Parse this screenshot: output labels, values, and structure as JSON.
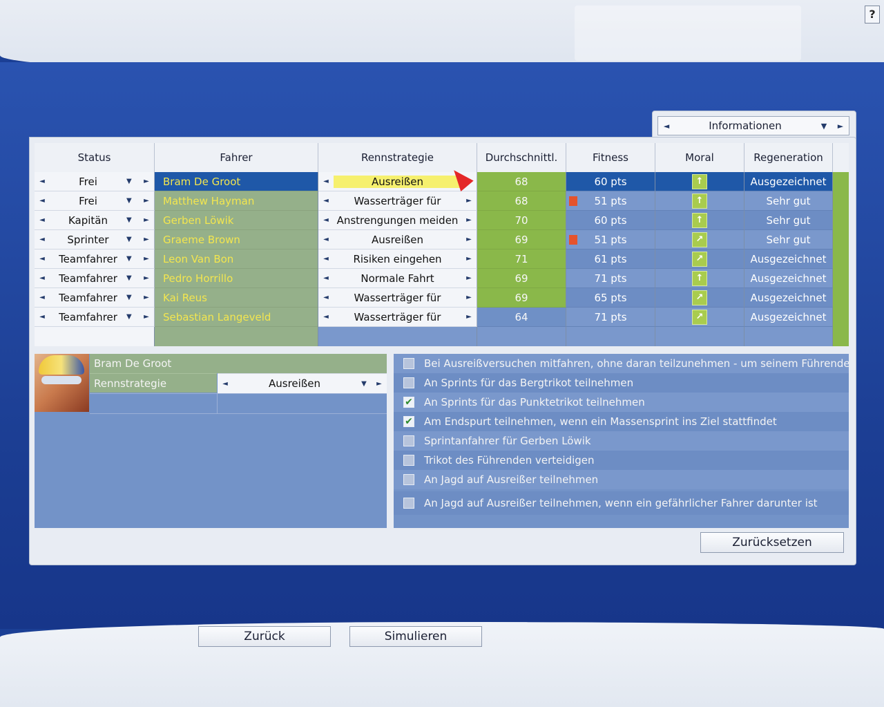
{
  "help_label": "?",
  "info_selector": {
    "label": "Informationen",
    "left_arrow": "◄",
    "right_arrow": "►",
    "dropdown": "▼"
  },
  "columns": [
    "Status",
    "Fahrer",
    "Rennstrategie",
    "Durchschnittl.",
    "Fitness",
    "Moral",
    "Regeneration"
  ],
  "riders": [
    {
      "status": "Frei",
      "name": "Bram De Groot",
      "strategy": "Ausreißen",
      "avg": "68",
      "fitness": "60 pts",
      "moral_icon": "arrow-up-icon",
      "regen": "Ausgezeichnet",
      "selected": true
    },
    {
      "status": "Frei",
      "name": "Matthew Hayman",
      "strategy": "Wasserträger für",
      "avg": "68",
      "fitness": "51 pts",
      "warning": true,
      "moral_icon": "arrow-up-icon",
      "regen": "Sehr gut"
    },
    {
      "status": "Kapitän",
      "name": "Gerben Löwik",
      "strategy": "Anstrengungen meiden",
      "avg": "70",
      "fitness": "60 pts",
      "moral_icon": "arrow-up-icon",
      "regen": "Sehr gut"
    },
    {
      "status": "Sprinter",
      "name": "Graeme Brown",
      "strategy": "Ausreißen",
      "avg": "69",
      "fitness": "51 pts",
      "warning": true,
      "moral_icon": "arrow-diag-icon",
      "regen": "Sehr gut"
    },
    {
      "status": "Teamfahrer",
      "name": "Leon Van Bon",
      "strategy": "Risiken eingehen",
      "avg": "71",
      "fitness": "61 pts",
      "moral_icon": "arrow-diag-icon",
      "regen": "Ausgezeichnet"
    },
    {
      "status": "Teamfahrer",
      "name": "Pedro Horrillo",
      "strategy": "Normale Fahrt",
      "avg": "69",
      "fitness": "71 pts",
      "moral_icon": "arrow-up-icon",
      "regen": "Ausgezeichnet"
    },
    {
      "status": "Teamfahrer",
      "name": "Kai Reus",
      "strategy": "Wasserträger für",
      "avg": "69",
      "fitness": "65 pts",
      "moral_icon": "arrow-diag-icon",
      "regen": "Ausgezeichnet"
    },
    {
      "status": "Teamfahrer",
      "name": "Sebastian Langeveld",
      "strategy": "Wasserträger für",
      "avg": "64",
      "fitness": "71 pts",
      "moral_icon": "arrow-diag-icon",
      "regen": "Ausgezeichnet"
    }
  ],
  "detail": {
    "name": "Bram De Groot",
    "label": "Rennstrategie",
    "value": "Ausreißen"
  },
  "options": [
    {
      "text": "Bei Ausreißversuchen mitfahren, ohne daran teilzunehmen - um seinem Führenden",
      "checked": false
    },
    {
      "text": "An Sprints für das Bergtrikot teilnehmen",
      "checked": false
    },
    {
      "text": "An Sprints für das Punktetrikot teilnehmen",
      "checked": true
    },
    {
      "text": "Am Endspurt teilnehmen, wenn ein Massensprint ins Ziel stattfindet",
      "checked": true
    },
    {
      "text": "Sprintanfahrer für Gerben Löwik",
      "checked": false
    },
    {
      "text": "Trikot des Führenden verteidigen",
      "checked": false
    },
    {
      "text": "An Jagd auf Ausreißer teilnehmen",
      "checked": false
    },
    {
      "text": "An Jagd auf Ausreißer teilnehmen, wenn ein gefährlicher Fahrer darunter ist",
      "checked": false
    }
  ],
  "buttons": {
    "reset": "Zurücksetzen",
    "back": "Zurück",
    "simulate": "Simulieren"
  },
  "colors": {
    "avg_green": "#8ab84a",
    "rider_green": "#95b08a",
    "selected_blue": "#1f58a8",
    "rider_text": "#f3e64f",
    "warning": "#e5532c"
  }
}
